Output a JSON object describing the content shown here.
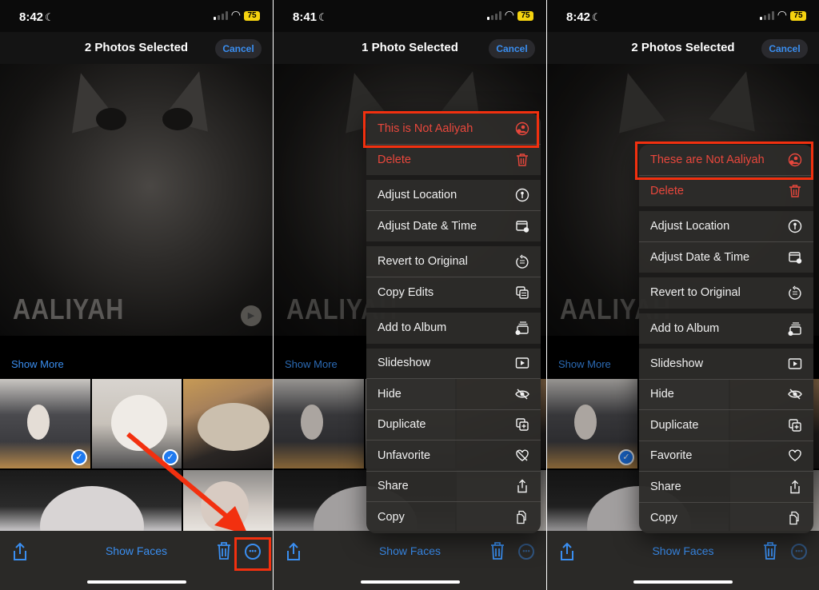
{
  "panels": [
    {
      "status": {
        "time": "8:42",
        "battery": "75"
      },
      "nav": {
        "title": "2 Photos Selected",
        "cancel": "Cancel"
      },
      "hero_name": "AALIYAH",
      "show_more": "Show More",
      "toolbar": {
        "show_faces": "Show Faces"
      }
    },
    {
      "status": {
        "time": "8:41",
        "battery": "75"
      },
      "nav": {
        "title": "1 Photo Selected",
        "cancel": "Cancel"
      },
      "hero_name": "AALIYAH",
      "show_more": "Show More",
      "toolbar": {
        "show_faces": "Show Faces"
      },
      "menu": [
        {
          "label": "This is Not Aaliyah",
          "icon": "person-remove-icon",
          "destructive": true
        },
        {
          "label": "Delete",
          "icon": "trash-icon",
          "destructive": true
        },
        {
          "label": "Adjust Location",
          "icon": "location-pin-icon"
        },
        {
          "label": "Adjust Date & Time",
          "icon": "calendar-clock-icon"
        },
        {
          "label": "Revert to Original",
          "icon": "revert-icon"
        },
        {
          "label": "Copy Edits",
          "icon": "copy-edits-icon"
        },
        {
          "label": "Add to Album",
          "icon": "add-to-album-icon"
        },
        {
          "label": "Slideshow",
          "icon": "play-rectangle-icon"
        },
        {
          "label": "Hide",
          "icon": "eye-slash-icon"
        },
        {
          "label": "Duplicate",
          "icon": "duplicate-icon"
        },
        {
          "label": "Unfavorite",
          "icon": "heart-slash-icon"
        },
        {
          "label": "Share",
          "icon": "share-icon"
        },
        {
          "label": "Copy",
          "icon": "copy-doc-icon"
        }
      ]
    },
    {
      "status": {
        "time": "8:42",
        "battery": "75"
      },
      "nav": {
        "title": "2 Photos Selected",
        "cancel": "Cancel"
      },
      "hero_name": "AALIYAH",
      "show_more": "Show More",
      "toolbar": {
        "show_faces": "Show Faces"
      },
      "menu": [
        {
          "label": "These are Not Aaliyah",
          "icon": "person-remove-icon",
          "destructive": true
        },
        {
          "label": "Delete",
          "icon": "trash-icon",
          "destructive": true
        },
        {
          "label": "Adjust Location",
          "icon": "location-pin-icon"
        },
        {
          "label": "Adjust Date & Time",
          "icon": "calendar-clock-icon"
        },
        {
          "label": "Revert to Original",
          "icon": "revert-icon"
        },
        {
          "label": "Add to Album",
          "icon": "add-to-album-icon"
        },
        {
          "label": "Slideshow",
          "icon": "play-rectangle-icon"
        },
        {
          "label": "Hide",
          "icon": "eye-slash-icon"
        },
        {
          "label": "Duplicate",
          "icon": "duplicate-icon"
        },
        {
          "label": "Favorite",
          "icon": "heart-icon"
        },
        {
          "label": "Share",
          "icon": "share-icon"
        },
        {
          "label": "Copy",
          "icon": "copy-doc-icon"
        }
      ]
    }
  ],
  "colors": {
    "accent": "#3a8ef0",
    "destructive": "#e8473c",
    "annotation": "#f2300f",
    "battery": "#f5d30f"
  }
}
